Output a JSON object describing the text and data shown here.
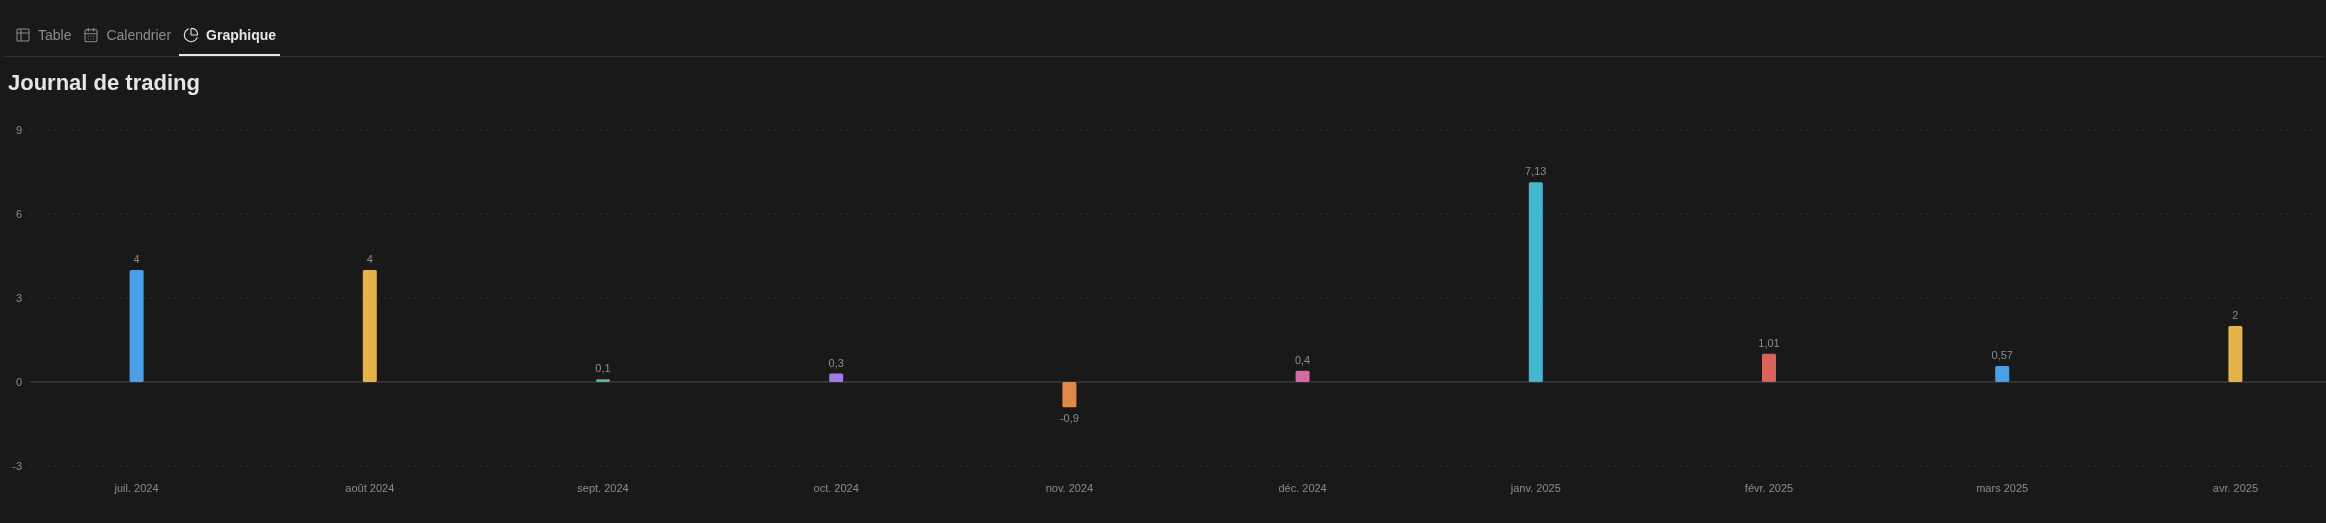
{
  "tabs": [
    {
      "label": "Table",
      "kind": "table",
      "selected": false
    },
    {
      "label": "Calendrier",
      "kind": "calendar",
      "selected": false
    },
    {
      "label": "Graphique",
      "kind": "chart",
      "selected": true
    }
  ],
  "title": "Journal de trading",
  "chart": {
    "chart_data": {
      "type": "bar",
      "categories": [
        "juil. 2024",
        "août 2024",
        "sept. 2024",
        "oct. 2024",
        "nov. 2024",
        "déc. 2024",
        "janv. 2025",
        "févr. 2025",
        "mars 2025",
        "avr. 2025"
      ],
      "values": [
        4,
        4,
        0.1,
        0.3,
        -0.9,
        0.4,
        7.13,
        1.01,
        0.57,
        2
      ],
      "colors": [
        "#4a9fe8",
        "#e4b44a",
        "#4fbf8a",
        "#a679e8",
        "#e0884a",
        "#d867a8",
        "#45b8d0",
        "#d9625a",
        "#4a9fe8",
        "#e4b44a"
      ],
      "value_labels": [
        "4",
        "4",
        "0,1",
        "0,3",
        "-0,9",
        "0,4",
        "7,13",
        "1,01",
        "0,57",
        "2"
      ],
      "ylim": [
        -3,
        9
      ],
      "yticks": [
        9,
        6,
        3,
        0,
        -3
      ]
    }
  }
}
